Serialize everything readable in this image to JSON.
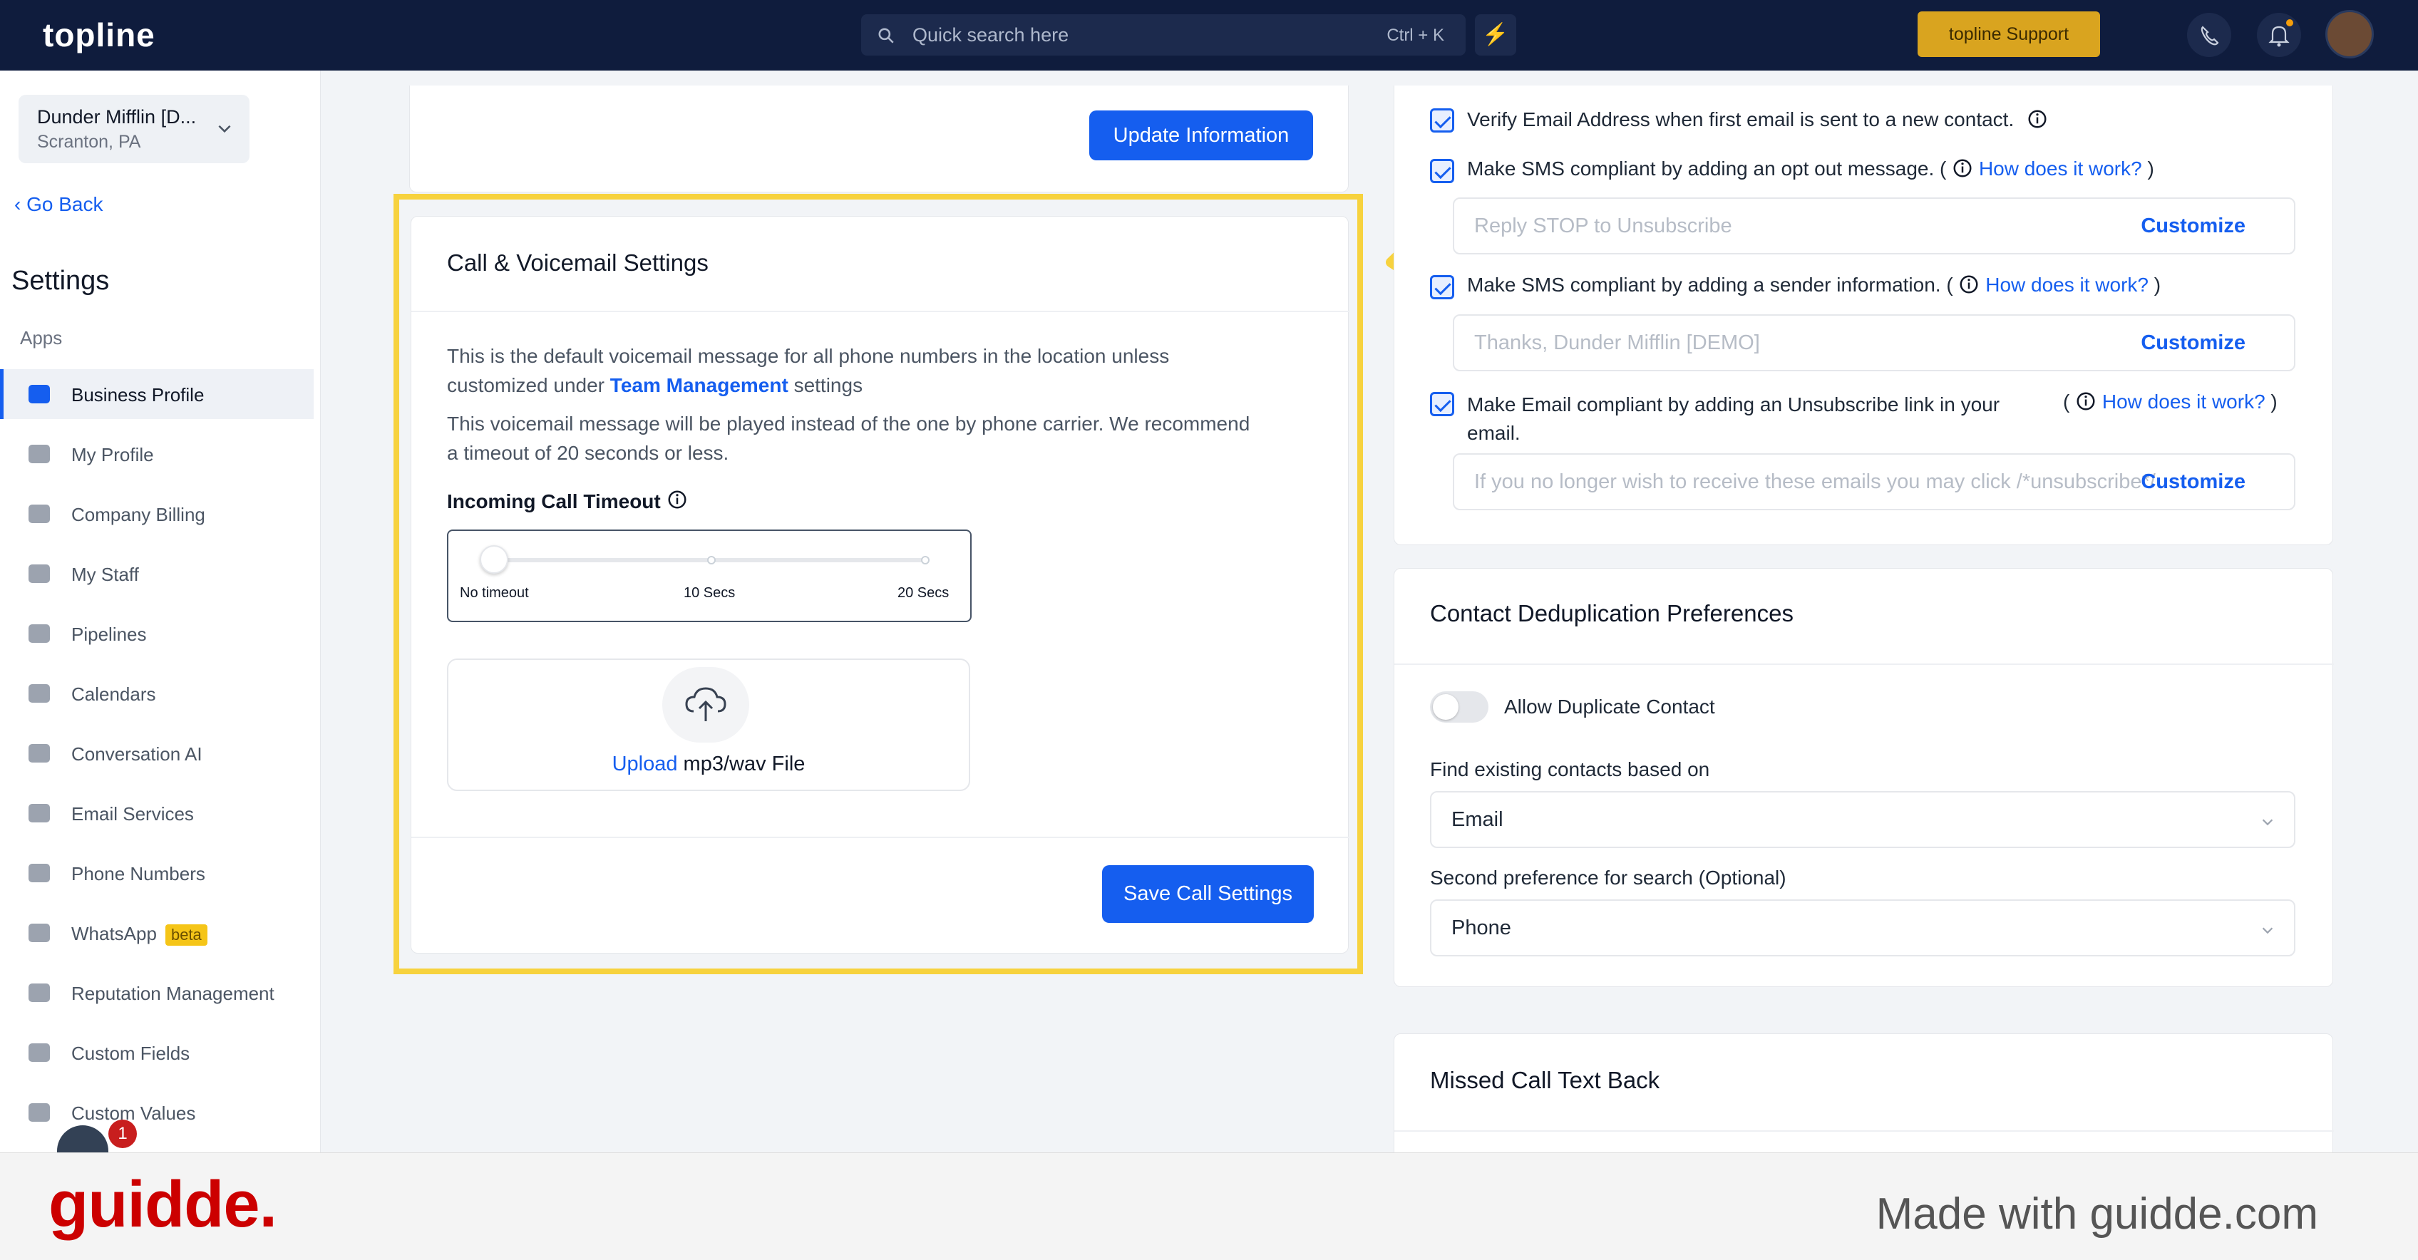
{
  "topbar": {
    "logo": "topline",
    "search_placeholder": "Quick search here",
    "search_shortcut": "Ctrl + K",
    "support_label": "topline Support"
  },
  "sidebar": {
    "location_name": "Dunder Mifflin [D...",
    "location_sub": "Scranton, PA",
    "go_back": "Go Back",
    "title": "Settings",
    "section": "Apps",
    "items": [
      {
        "label": "Business Profile",
        "icon": "briefcase-icon",
        "active": true
      },
      {
        "label": "My Profile",
        "icon": "user-icon"
      },
      {
        "label": "Company Billing",
        "icon": "billing-icon"
      },
      {
        "label": "My Staff",
        "icon": "staff-icon"
      },
      {
        "label": "Pipelines",
        "icon": "pipeline-icon"
      },
      {
        "label": "Calendars",
        "icon": "calendar-icon"
      },
      {
        "label": "Conversation AI",
        "icon": "chat-icon"
      },
      {
        "label": "Email Services",
        "icon": "mail-icon"
      },
      {
        "label": "Phone Numbers",
        "icon": "phone-icon"
      },
      {
        "label": "WhatsApp",
        "icon": "whatsapp-icon",
        "badge": "beta"
      },
      {
        "label": "Reputation Management",
        "icon": "star-icon"
      },
      {
        "label": "Custom Fields",
        "icon": "fields-icon"
      },
      {
        "label": "Custom Values",
        "icon": "values-icon"
      }
    ],
    "chat_badge_count": "1"
  },
  "main": {
    "update_button": "Update Information",
    "call_card": {
      "title": "Call & Voicemail Settings",
      "desc1_pre": "This is the default voicemail message for all phone numbers in the location unless",
      "desc1_mid": "customized under ",
      "desc1_link": "Team Management",
      "desc1_post": " settings",
      "desc2_line1": "This voicemail message will be played instead of the one by phone carrier. We recommend",
      "desc2_line2": "a timeout of 20 seconds or less.",
      "timeout_label": "Incoming Call Timeout",
      "slider_value": 0,
      "slider_ticks": [
        "No timeout",
        "10 Secs",
        "20 Secs"
      ],
      "upload_link": "Upload",
      "upload_text": " mp3/wav File",
      "save_button": "Save Call Settings"
    }
  },
  "right": {
    "verify_email": "Verify Email Address when first email is sent to a new contact.",
    "sms_optout": "Make SMS compliant by adding an opt out message.",
    "how_link": "How does it work?",
    "sms_optout_placeholder": "Reply STOP to Unsubscribe",
    "customize": "Customize",
    "sms_sender": "Make SMS compliant by adding a sender information.",
    "sms_sender_placeholder": "Thanks, Dunder Mifflin [DEMO]",
    "email_unsub_line1": "Make Email compliant by adding an Unsubscribe link in your",
    "email_unsub_line2": "email.",
    "email_unsub_placeholder": "If you no longer wish to receive these emails you may click /*unsubscribe*/",
    "dedup_title": "Contact Deduplication Preferences",
    "allow_duplicate": "Allow Duplicate Contact",
    "find_label": "Find existing contacts based on",
    "find_value": "Email",
    "second_label": "Second preference for search (Optional)",
    "second_value": "Phone",
    "missed_title": "Missed Call Text Back"
  },
  "footer": {
    "brand": "guidde.",
    "made_with": "Made with guidde.com"
  },
  "colors": {
    "topbar": "#0f1c3d",
    "accent": "#155eef",
    "highlight": "#f7d23e",
    "support": "#d9a41f",
    "guidde_red": "#cc0000"
  }
}
